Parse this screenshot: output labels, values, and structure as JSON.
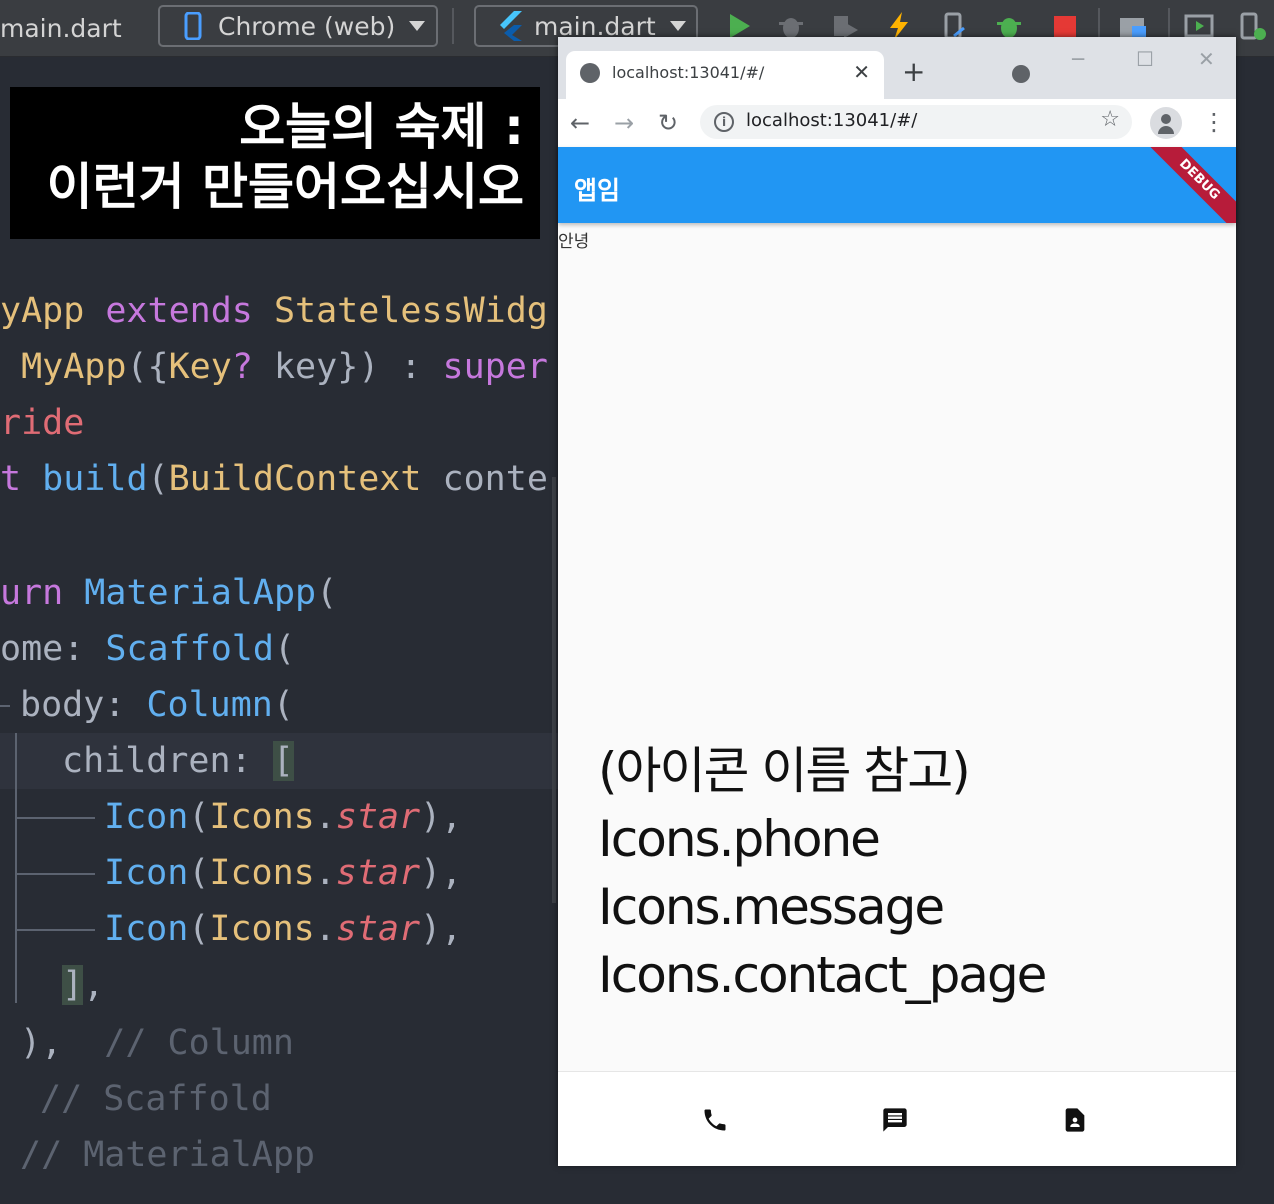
{
  "ide": {
    "file_tab": "main.dart",
    "device_selector": "Chrome (web)",
    "run_config": "main.dart"
  },
  "overlay": {
    "line1": "오늘의 숙제 :",
    "line2": "이런거 만들어오십시오"
  },
  "code": {
    "class_decl": [
      "yApp ",
      "extends ",
      "StatelessWidg"
    ],
    "ctor": [
      " MyApp",
      "({",
      "Key",
      "? ",
      "key",
      "}) : ",
      "super"
    ],
    "override": "ride",
    "build": [
      "t ",
      "build",
      "(",
      "BuildContext",
      " conte"
    ],
    "return": [
      "urn ",
      "MaterialApp",
      "("
    ],
    "home": [
      "ome: ",
      "Scaffold",
      "("
    ],
    "body": [
      "body: ",
      "Column",
      "("
    ],
    "children": [
      "children: ",
      "["
    ],
    "icon_lines": [
      [
        "Icon",
        "(",
        "Icons",
        ".",
        "star",
        "),"
      ],
      [
        "Icon",
        "(",
        "Icons",
        ".",
        "star",
        "),"
      ],
      [
        "Icon",
        "(",
        "Icons",
        ".",
        "star",
        "),"
      ]
    ],
    "close_children": [
      "]",
      ","
    ],
    "close_column": [
      "),  ",
      "// Column"
    ],
    "comment_scaffold": "// Scaffold",
    "comment_materialapp": "// MaterialApp"
  },
  "browser": {
    "tab_title": "localhost:13041/#/",
    "address": "localhost:13041/#/"
  },
  "app": {
    "appbar_title": "앱임",
    "debug_banner": "DEBUG",
    "body_text": "안녕",
    "instructions": [
      "(아이콘 이름 참고)",
      "Icons.phone",
      "Icons.message",
      "Icons.contact_page"
    ],
    "bottom_icons": [
      "phone-icon",
      "message-icon",
      "contact-page-icon"
    ]
  },
  "colors": {
    "appbar": "#2196f3",
    "editor_bg": "#282c34",
    "keyword": "#c678dd",
    "class": "#e5c07b",
    "function": "#61afef"
  }
}
